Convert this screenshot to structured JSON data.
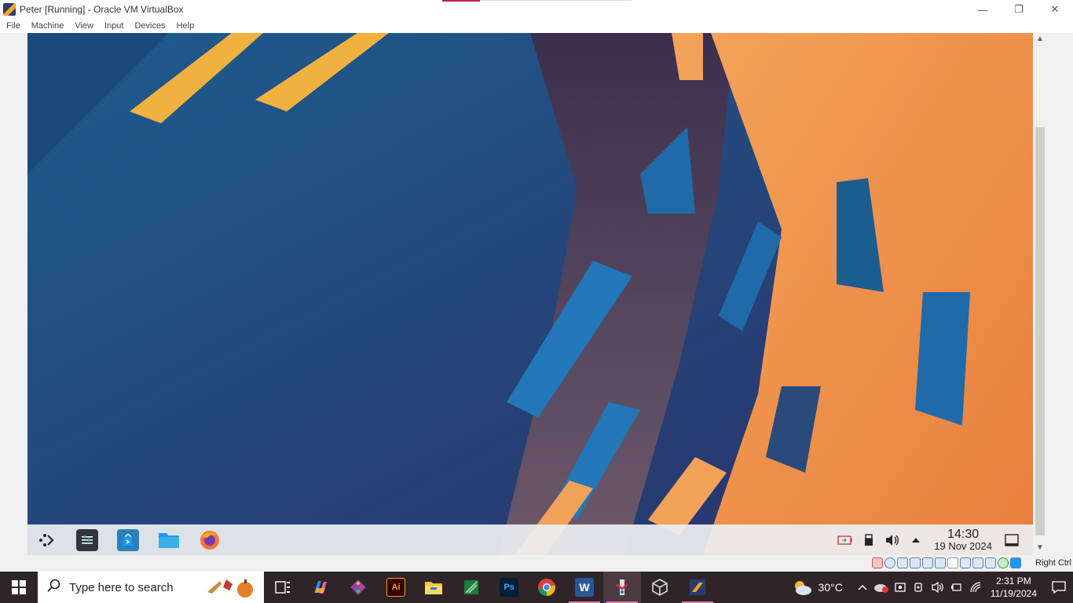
{
  "window": {
    "title": "Peter [Running] - Oracle VM VirtualBox",
    "controls": {
      "minimize": "—",
      "restore": "❐",
      "close": "✕"
    }
  },
  "menubar": {
    "items": [
      "File",
      "Machine",
      "View",
      "Input",
      "Devices",
      "Help"
    ]
  },
  "vm": {
    "kde_panel": {
      "launchers": [
        {
          "name": "application-launcher-icon"
        },
        {
          "name": "system-settings-icon"
        },
        {
          "name": "discover-store-icon"
        },
        {
          "name": "dolphin-file-manager-icon"
        },
        {
          "name": "firefox-icon"
        }
      ],
      "clock_time": "14:30",
      "clock_date": "19 Nov 2024"
    }
  },
  "statusbar": {
    "host_key": "Right Ctrl"
  },
  "taskbar": {
    "search_placeholder": "Type here to search",
    "apps": [
      {
        "name": "task-view-icon",
        "label": ""
      },
      {
        "name": "copilot-icon",
        "label": ""
      },
      {
        "name": "git-icon",
        "label": ""
      },
      {
        "name": "illustrator-icon",
        "label": "Ai"
      },
      {
        "name": "file-explorer-icon",
        "label": ""
      },
      {
        "name": "spreadsheet-icon",
        "label": ""
      },
      {
        "name": "photoshop-icon",
        "label": "Ps"
      },
      {
        "name": "chrome-icon",
        "label": ""
      },
      {
        "name": "word-icon",
        "label": "W"
      },
      {
        "name": "fiddler-icon",
        "label": ""
      },
      {
        "name": "cube-app-icon",
        "label": ""
      },
      {
        "name": "virtualbox-icon",
        "label": ""
      }
    ],
    "weather": "30°C",
    "clock_time": "2:31 PM",
    "clock_date": "11/19/2024"
  },
  "colors": {
    "taskbar_bg": "#2f2528",
    "active_indicator": "#d67ea7",
    "title_accent": "#c2185b"
  }
}
